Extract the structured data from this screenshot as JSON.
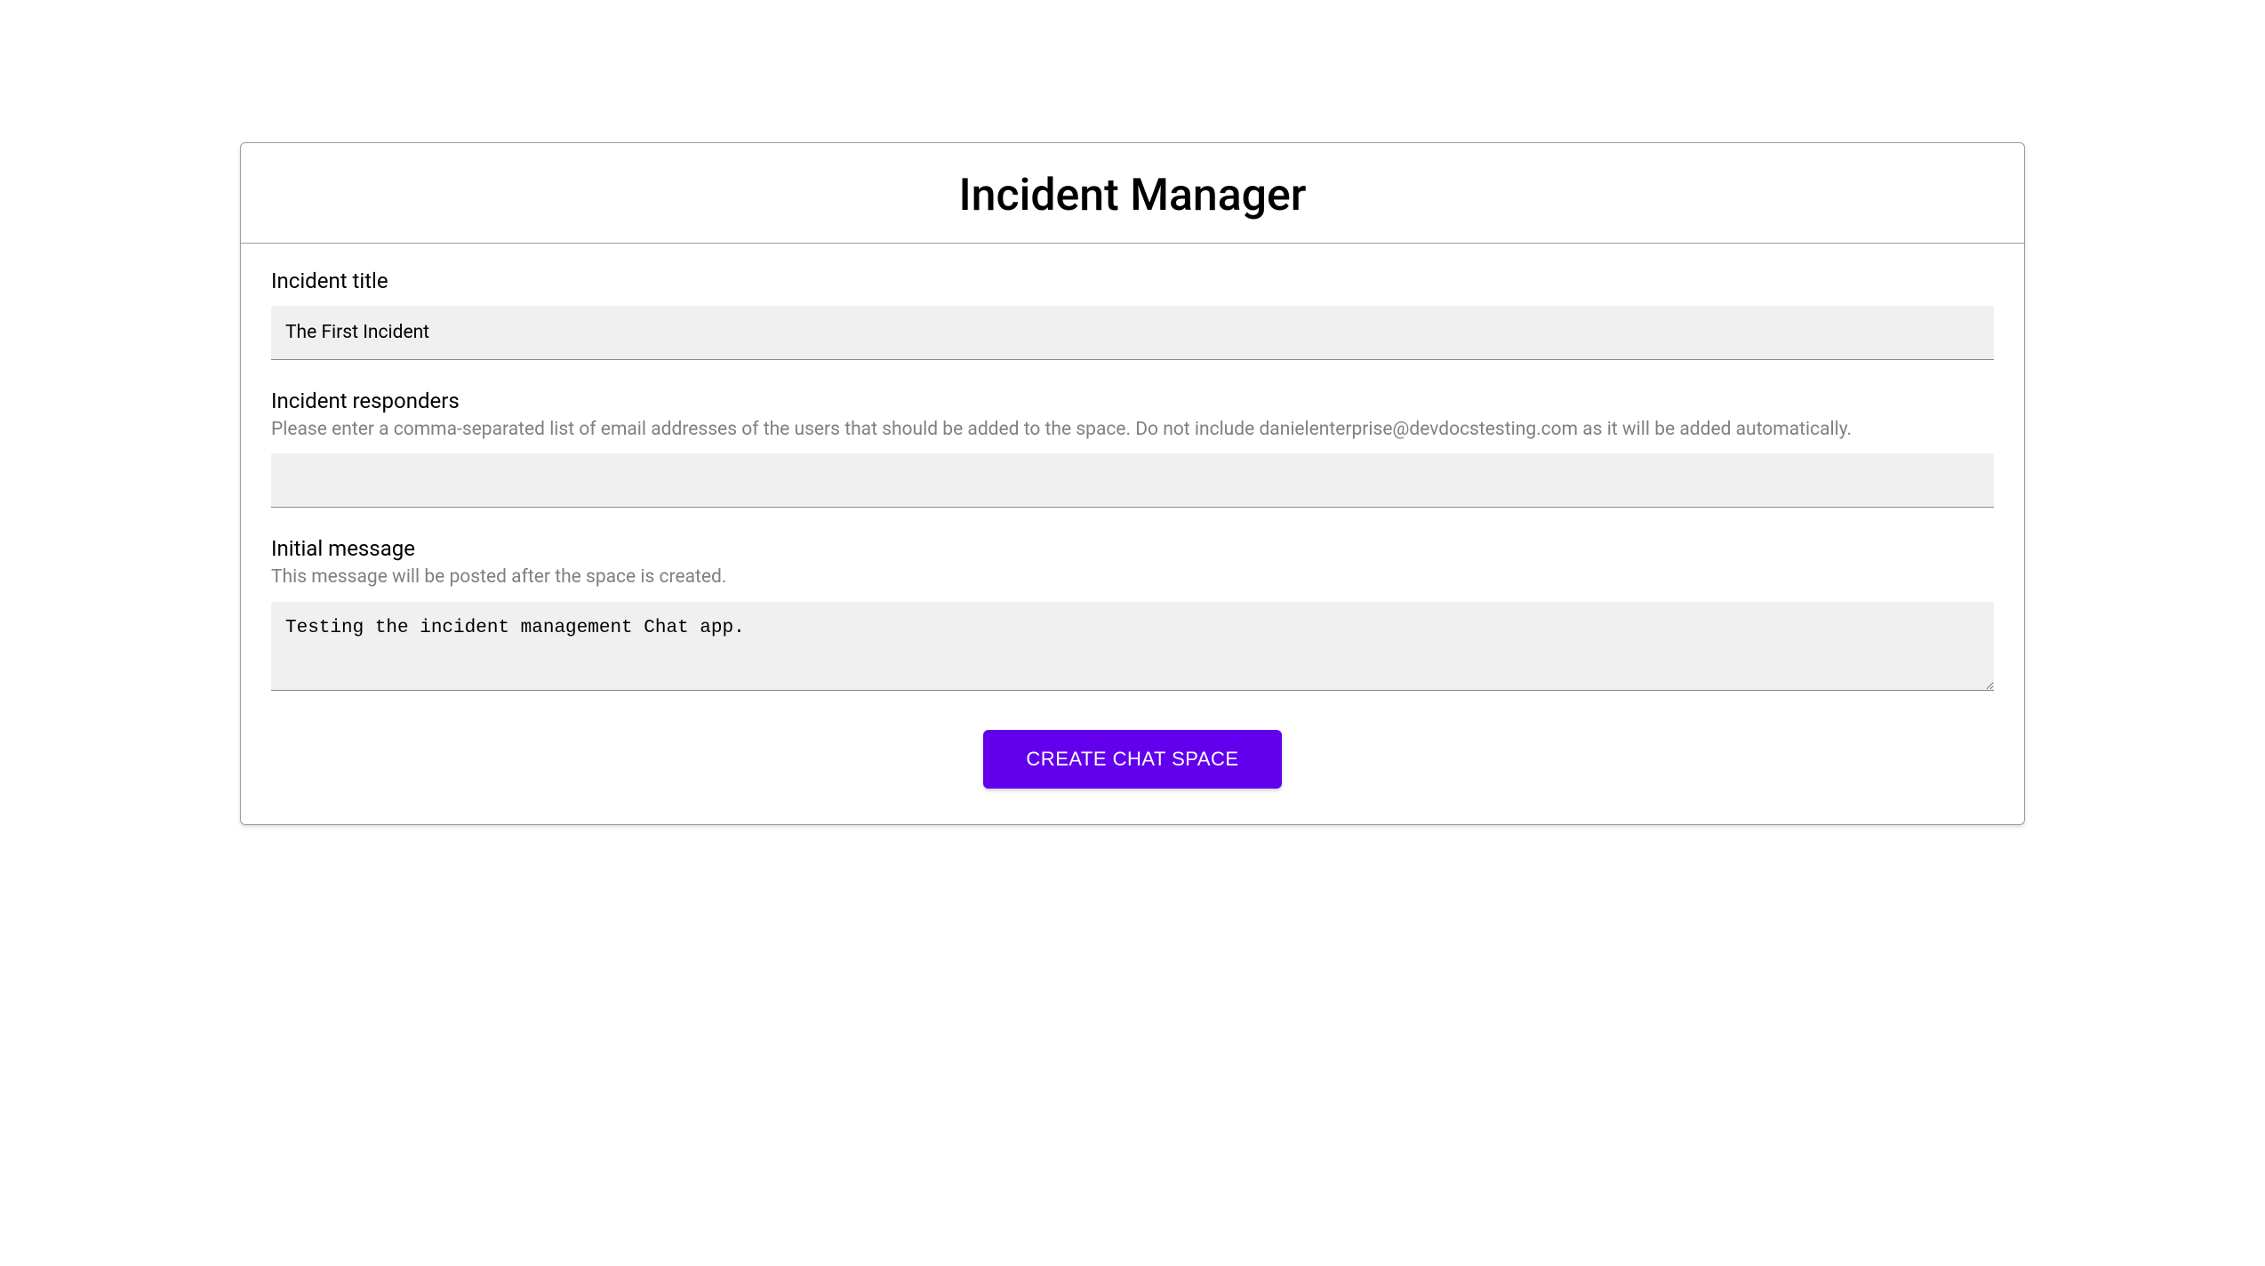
{
  "header": {
    "title": "Incident Manager"
  },
  "form": {
    "incident_title": {
      "label": "Incident title",
      "value": "The First Incident"
    },
    "incident_responders": {
      "label": "Incident responders",
      "helper": "Please enter a comma-separated list of email addresses of the users that should be added to the space. Do not include danielenterprise@devdocstesting.com as it will be added automatically.",
      "value": ""
    },
    "initial_message": {
      "label": "Initial message",
      "helper": "This message will be posted after the space is created.",
      "value": "Testing the incident management Chat app."
    },
    "submit_label": "CREATE CHAT SPACE"
  }
}
